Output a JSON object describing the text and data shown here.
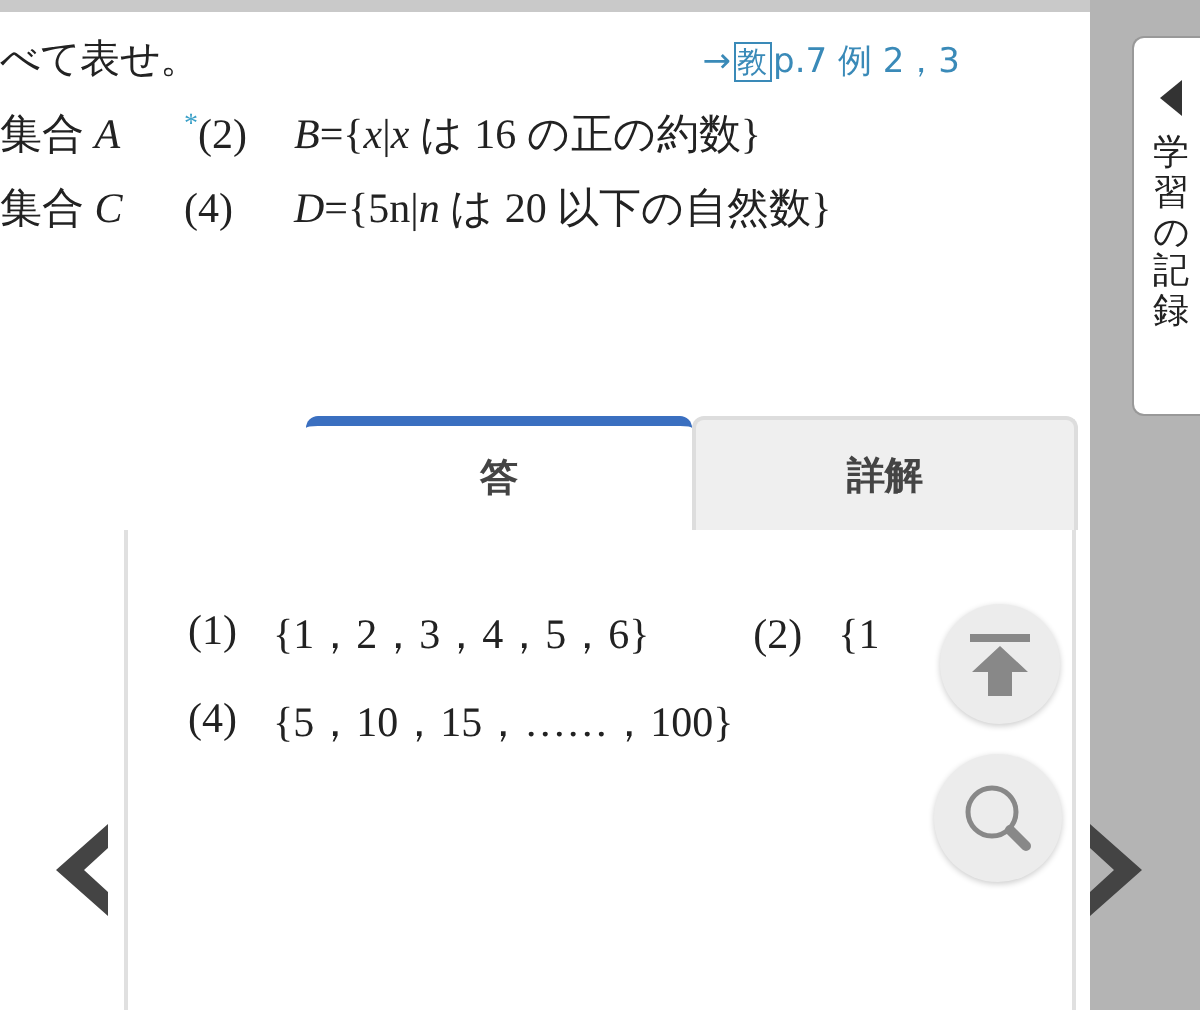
{
  "problem": {
    "lead": "べて表せ。",
    "reference": {
      "arrow": "→",
      "book": "教",
      "text": "p.7 例 2，3"
    },
    "rows": [
      {
        "left": "集合 *A*",
        "mark": "*",
        "number": "(2)",
        "statement": "*B*={*x*|*x* は 16 の正の約数}"
      },
      {
        "left": "集合 *C*",
        "number": "(4)",
        "statement": "*D*={5n|*n* は 20 以下の自然数}"
      }
    ]
  },
  "tabs": [
    {
      "label": "答",
      "selected": true
    },
    {
      "label": "詳解",
      "selected": false
    }
  ],
  "answers": [
    [
      {
        "number": "(1)",
        "value": "{1，2，3，4，5，6}"
      },
      {
        "number": "(2)",
        "value": "{1"
      }
    ],
    [
      {
        "number": "(4)",
        "value": "{5，10，15，……，100}"
      }
    ]
  ],
  "side_tab": {
    "label": "学習の記録"
  }
}
